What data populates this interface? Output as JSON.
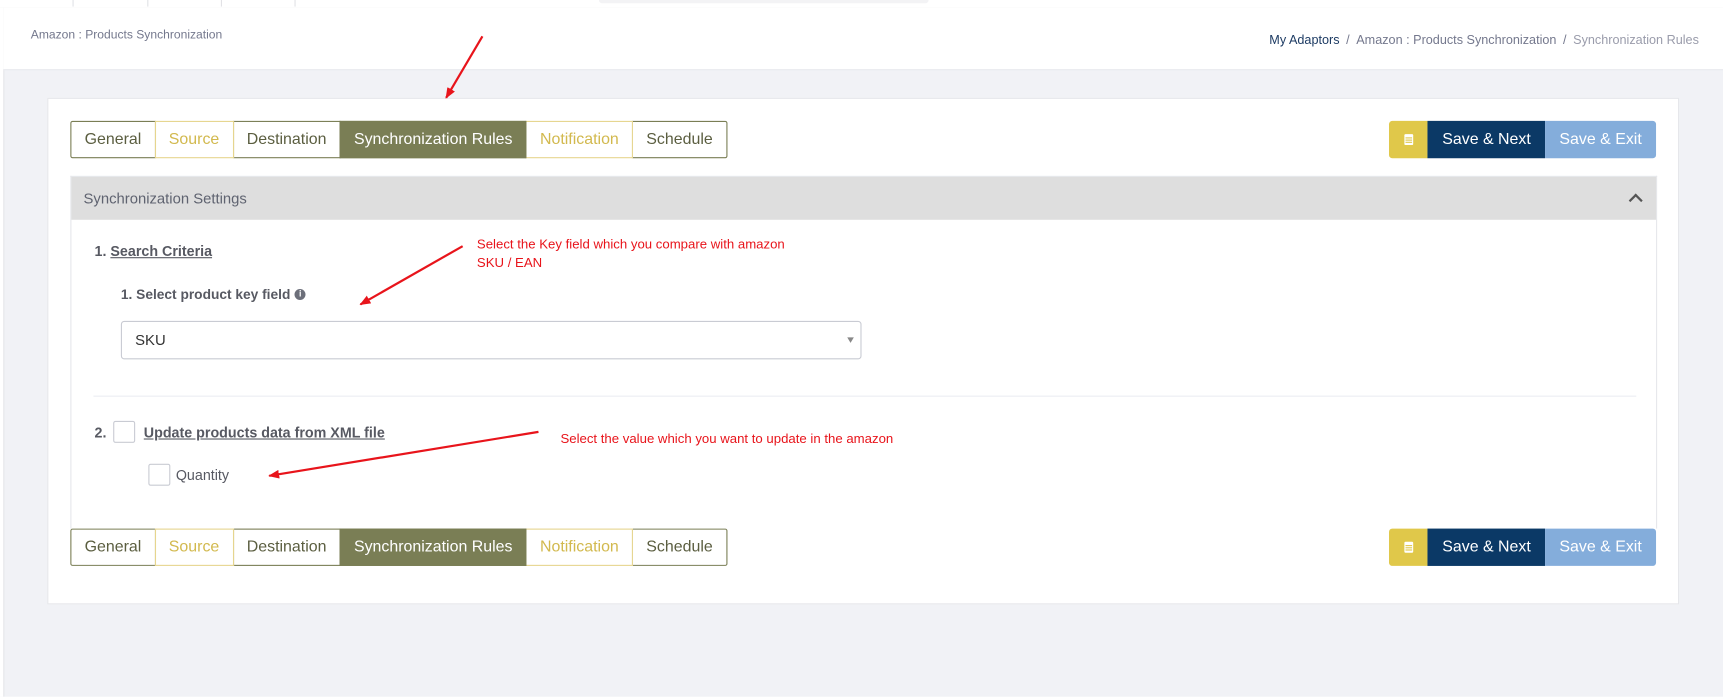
{
  "header": {
    "title": "Amazon : Products Synchronization",
    "breadcrumb": [
      "My Adaptors",
      "Amazon : Products Synchronization",
      "Synchronization Rules"
    ]
  },
  "tabs": [
    {
      "label": "General",
      "style": "olive"
    },
    {
      "label": "Source",
      "style": "yellow"
    },
    {
      "label": "Destination",
      "style": "olive"
    },
    {
      "label": "Synchronization Rules",
      "style": "active"
    },
    {
      "label": "Notification",
      "style": "yellow"
    },
    {
      "label": "Schedule",
      "style": "olive"
    }
  ],
  "buttons": {
    "save_next": "Save & Next",
    "save_exit": "Save & Exit"
  },
  "panel": {
    "title": "Synchronization Settings",
    "section1": {
      "number": "1.",
      "title": "Search Criteria",
      "sub_label": "1. Select product key field",
      "selected_value": "SKU"
    },
    "section2": {
      "number": "2.",
      "title": "Update products data from XML file",
      "checked": false,
      "option_label": "Quantity",
      "option_checked": false
    }
  },
  "annotations": {
    "note1_line1": "Select the Key field which you compare with amazon",
    "note1_line2": "SKU / EAN",
    "note2": "Select the value which you want to update in the amazon"
  },
  "colors": {
    "olive": "#7a7e55",
    "yellow": "#e0c84a",
    "navy": "#0b3966",
    "light_blue": "#84addb",
    "annotation_red": "#e8141b"
  }
}
